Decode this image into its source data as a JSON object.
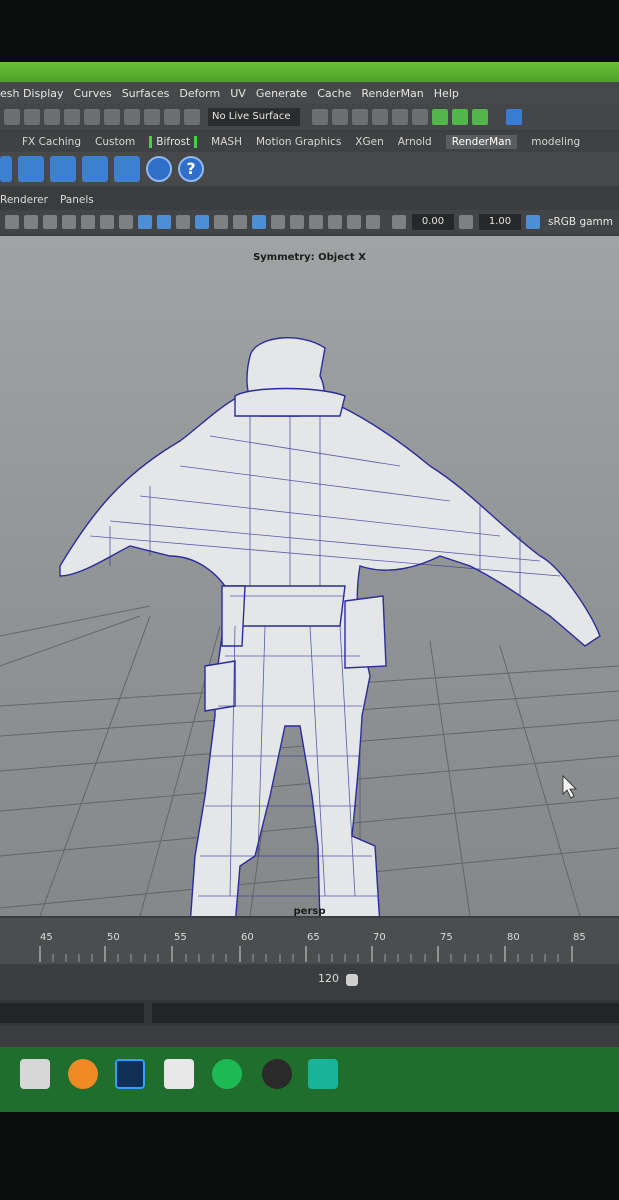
{
  "menu": [
    "esh Display",
    "Curves",
    "Surfaces",
    "Deform",
    "UV",
    "Generate",
    "Cache",
    "RenderMan",
    "Help"
  ],
  "status": {
    "live_surface": "No Live Surface"
  },
  "shelf_tabs": [
    {
      "label": "FX Caching"
    },
    {
      "label": "Custom"
    },
    {
      "label": "Bifrost"
    },
    {
      "label": "MASH"
    },
    {
      "label": "Motion Graphics"
    },
    {
      "label": "XGen"
    },
    {
      "label": "Arnold"
    },
    {
      "label": "RenderMan"
    },
    {
      "label": "modeling"
    }
  ],
  "shelf_icons": [
    "renderman-icon",
    "renderman-icon",
    "renderman-icon",
    "renderman-icon",
    "renderman-icon",
    "renderman-round-icon",
    "help-icon"
  ],
  "panel_menu": [
    "Renderer",
    "Panels"
  ],
  "view_toolbar": {
    "exposure": "0.00",
    "gamma": "1.00",
    "colorspace": "sRGB gamm"
  },
  "viewport": {
    "symmetry": "Symmetry: Object X",
    "camera": "persp"
  },
  "timeline": {
    "ticks": [
      "45",
      "50",
      "55",
      "60",
      "65",
      "70",
      "75",
      "80",
      "85"
    ]
  },
  "range": {
    "end_value": "120"
  },
  "taskbar": [
    "explorer-icon",
    "blender-icon",
    "photoshop-icon",
    "zbrush-icon",
    "spotify-icon",
    "app-icon",
    "maya-icon"
  ],
  "colors": {
    "accent": "#5ec734",
    "wire": "#2a2c9c",
    "mesh": "#e4e6e8",
    "taskbar_green": "#2c8f3a"
  }
}
